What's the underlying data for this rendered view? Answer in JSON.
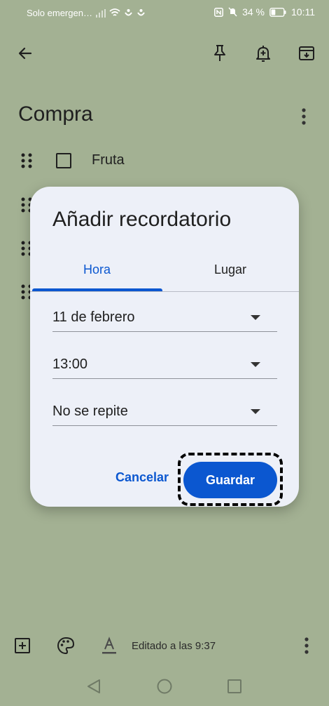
{
  "status_bar": {
    "carrier": "Solo emergen…",
    "battery_percent": "34 %",
    "time": "10:11",
    "battery_level": 0.34
  },
  "top_bar": {
    "icons": [
      "back-arrow-icon",
      "pin-icon",
      "reminder-bell-icon",
      "archive-icon"
    ]
  },
  "note": {
    "title": "Compra",
    "items": [
      {
        "text": "Fruta",
        "checked": false
      }
    ]
  },
  "dialog": {
    "title": "Añadir recordatorio",
    "tabs": [
      {
        "label": "Hora",
        "selected": true
      },
      {
        "label": "Lugar",
        "selected": false
      }
    ],
    "date": "11 de febrero",
    "time": "13:00",
    "repeat": "No se repite",
    "cancel_label": "Cancelar",
    "save_label": "Guardar"
  },
  "bottom_bar": {
    "edited": "Editado a las 9:37",
    "icons": [
      "add-box-icon",
      "palette-icon",
      "text-format-icon",
      "more-vert-icon"
    ]
  },
  "colors": {
    "background": "#a3b193",
    "dialog": "#edf0f8",
    "accent": "#0b57d0"
  }
}
